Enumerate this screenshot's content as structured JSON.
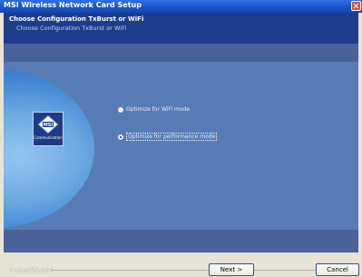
{
  "window": {
    "title": "MSI Wireless Network Card Setup"
  },
  "header": {
    "title": "Choose Configuration TxBurst or WiFi",
    "subtitle": "Choose Configuration TxBurst or WiFi"
  },
  "logo": {
    "emblem_text": "MSI",
    "caption": "Communication"
  },
  "options": [
    {
      "label": "Optimize for WiFi mode",
      "selected": false
    },
    {
      "label": "Optimize for performance mode",
      "selected": true
    }
  ],
  "footer": {
    "brand": "InstallShield",
    "next_label": "Next >",
    "cancel_label": "Cancel"
  },
  "colors": {
    "title_bar": "#1a52c7",
    "header": "#1d3d8b",
    "panel": "#4a6299",
    "footer": "#e6e3d6"
  }
}
